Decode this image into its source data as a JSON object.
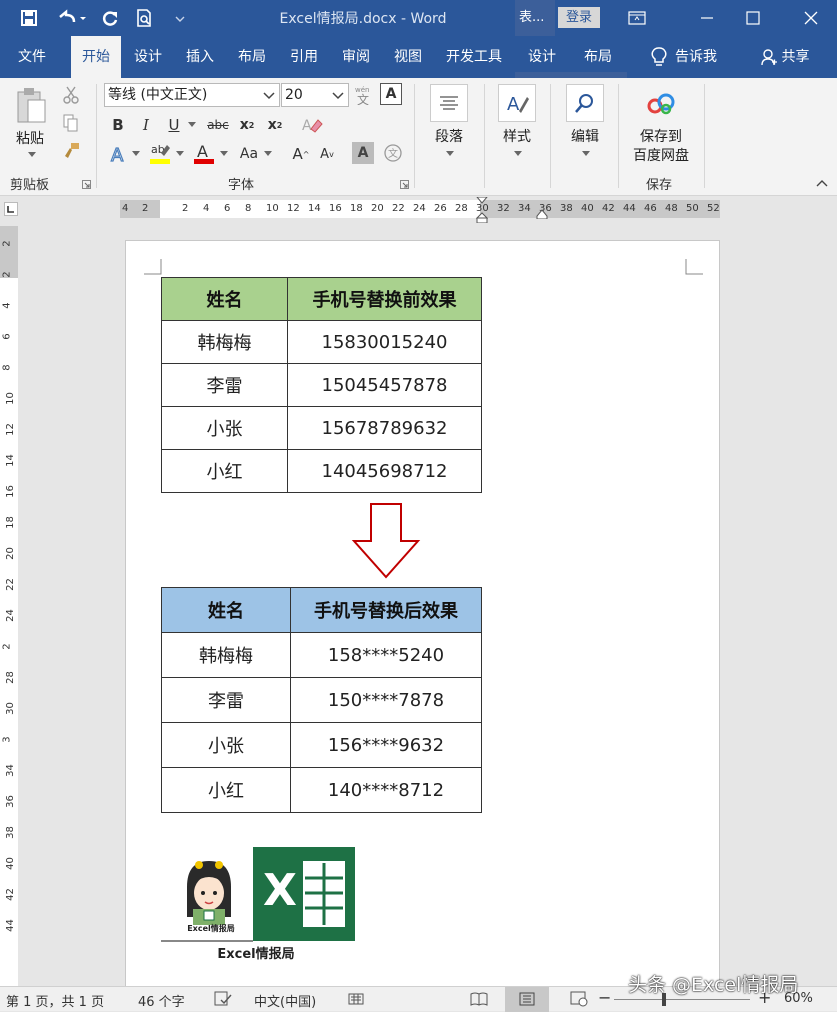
{
  "window": {
    "title": "Excel情报局.docx  -  Word",
    "context_tab": "表...",
    "login_label": "登录"
  },
  "tabs": [
    {
      "label": "文件"
    },
    {
      "label": "开始"
    },
    {
      "label": "设计"
    },
    {
      "label": "插入"
    },
    {
      "label": "布局"
    },
    {
      "label": "引用"
    },
    {
      "label": "审阅"
    },
    {
      "label": "视图"
    },
    {
      "label": "开发工具"
    },
    {
      "label": "设计"
    },
    {
      "label": "布局"
    }
  ],
  "tell_me": "告诉我",
  "share": "共享",
  "ribbon": {
    "clipboard": {
      "paste_label": "粘贴",
      "group_label": "剪贴板"
    },
    "font": {
      "name": "等线 (中文正文)",
      "size": "20",
      "group_label": "字体",
      "wen_label": "文"
    },
    "paragraph": {
      "label": "段落"
    },
    "styles": {
      "label": "样式"
    },
    "editing": {
      "label": "编辑"
    },
    "save": {
      "line1": "保存到",
      "line2": "百度网盘",
      "group_label": "保存"
    }
  },
  "ruler": {
    "h_numbers": [
      "4",
      "2",
      "2",
      "4",
      "6",
      "8",
      "10",
      "12",
      "14",
      "16",
      "18",
      "20",
      "22",
      "24",
      "26",
      "28",
      "30",
      "32",
      "34",
      "36",
      "38",
      "40",
      "42",
      "44",
      "46",
      "48",
      "50",
      "52"
    ],
    "v_numbers": [
      "2",
      "2",
      "4",
      "6",
      "8",
      "10",
      "12",
      "14",
      "16",
      "18",
      "20",
      "22",
      "24",
      "2",
      "28",
      "30",
      "3",
      "34",
      "36",
      "38",
      "40",
      "42",
      "44"
    ]
  },
  "table_before": {
    "headers": [
      "姓名",
      "手机号替换前效果"
    ],
    "rows": [
      [
        "韩梅梅",
        "15830015240"
      ],
      [
        "李雷",
        "15045457878"
      ],
      [
        "小张",
        "15678789632"
      ],
      [
        "小红",
        "14045698712"
      ]
    ]
  },
  "table_after": {
    "headers": [
      "姓名",
      "手机号替换后效果"
    ],
    "rows": [
      [
        "韩梅梅",
        "158****5240"
      ],
      [
        "李雷",
        "150****7878"
      ],
      [
        "小张",
        "156****9632"
      ],
      [
        "小红",
        "140****8712"
      ]
    ]
  },
  "logo": {
    "small_text": "Excel情报局",
    "caption": "Excel情报局",
    "excel_letter": "X"
  },
  "status": {
    "page": "第 1 页，共 1 页",
    "words": "46 个字",
    "language": "中文(中国)",
    "zoom": "60%"
  },
  "watermark": "头条 @Excel情报局",
  "colors": {
    "brand": "#2b579a",
    "head_green": "#a9d18e",
    "head_blue": "#9dc3e6",
    "arrow_red": "#c00000",
    "excel_green": "#1e7145"
  }
}
